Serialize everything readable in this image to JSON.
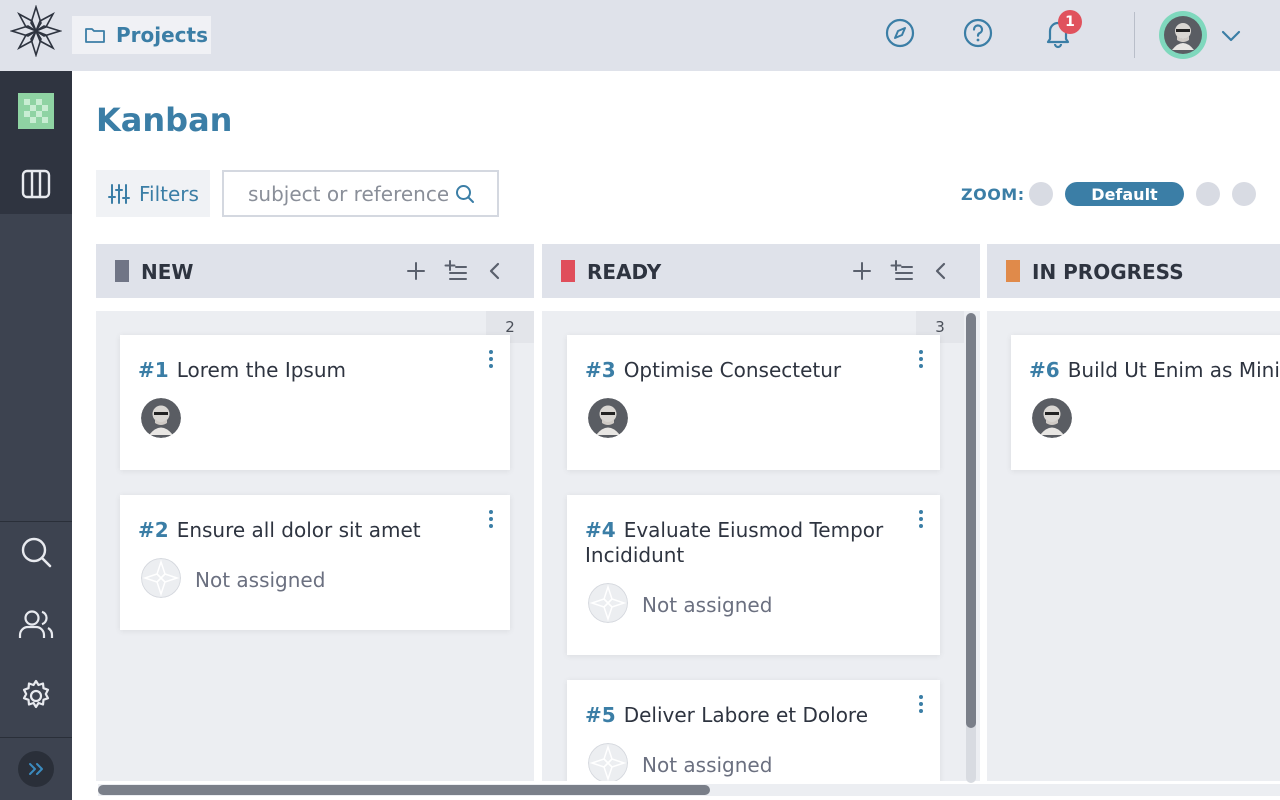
{
  "topbar": {
    "project_label": "Projects",
    "notification_count": "1",
    "icons": [
      "logo-icon",
      "folder-icon",
      "compass-icon",
      "help-icon",
      "bell-icon",
      "avatar",
      "chevron-down-icon"
    ]
  },
  "sidebar": {
    "items": [
      "project-avatar",
      "kanban-icon",
      "search-icon",
      "users-icon",
      "settings-icon",
      "expand-icon"
    ]
  },
  "page": {
    "title": "Kanban",
    "filters_label": "Filters",
    "search_placeholder": "subject or reference",
    "zoom_label": "ZOOM:",
    "zoom_default": "Default"
  },
  "columns": [
    {
      "name": "NEW",
      "color": "#707586",
      "count": "2",
      "cards": [
        {
          "ref": "#1",
          "title": "Lorem the Ipsum",
          "assignee": ""
        },
        {
          "ref": "#2",
          "title": "Ensure all dolor sit amet",
          "assignee": "Not assigned"
        }
      ]
    },
    {
      "name": "READY",
      "color": "#e04e5b",
      "count": "3",
      "cards": [
        {
          "ref": "#3",
          "title": "Optimise Consectetur",
          "assignee": ""
        },
        {
          "ref": "#4",
          "title": "Evaluate Eiusmod Tempor Incididunt",
          "assignee": "Not assigned"
        },
        {
          "ref": "#5",
          "title": "Deliver Labore et Dolore",
          "assignee": "Not assigned"
        }
      ]
    },
    {
      "name": "IN PROGRESS",
      "color": "#e08a4a",
      "count": "",
      "cards": [
        {
          "ref": "#6",
          "title": "Build Ut Enim as Minim",
          "assignee": ""
        }
      ]
    }
  ],
  "colors": {
    "accent": "#3b7ea6",
    "topbar": "#dfe2ea",
    "sidebar": "#3d4350",
    "badge": "#e0525d"
  }
}
